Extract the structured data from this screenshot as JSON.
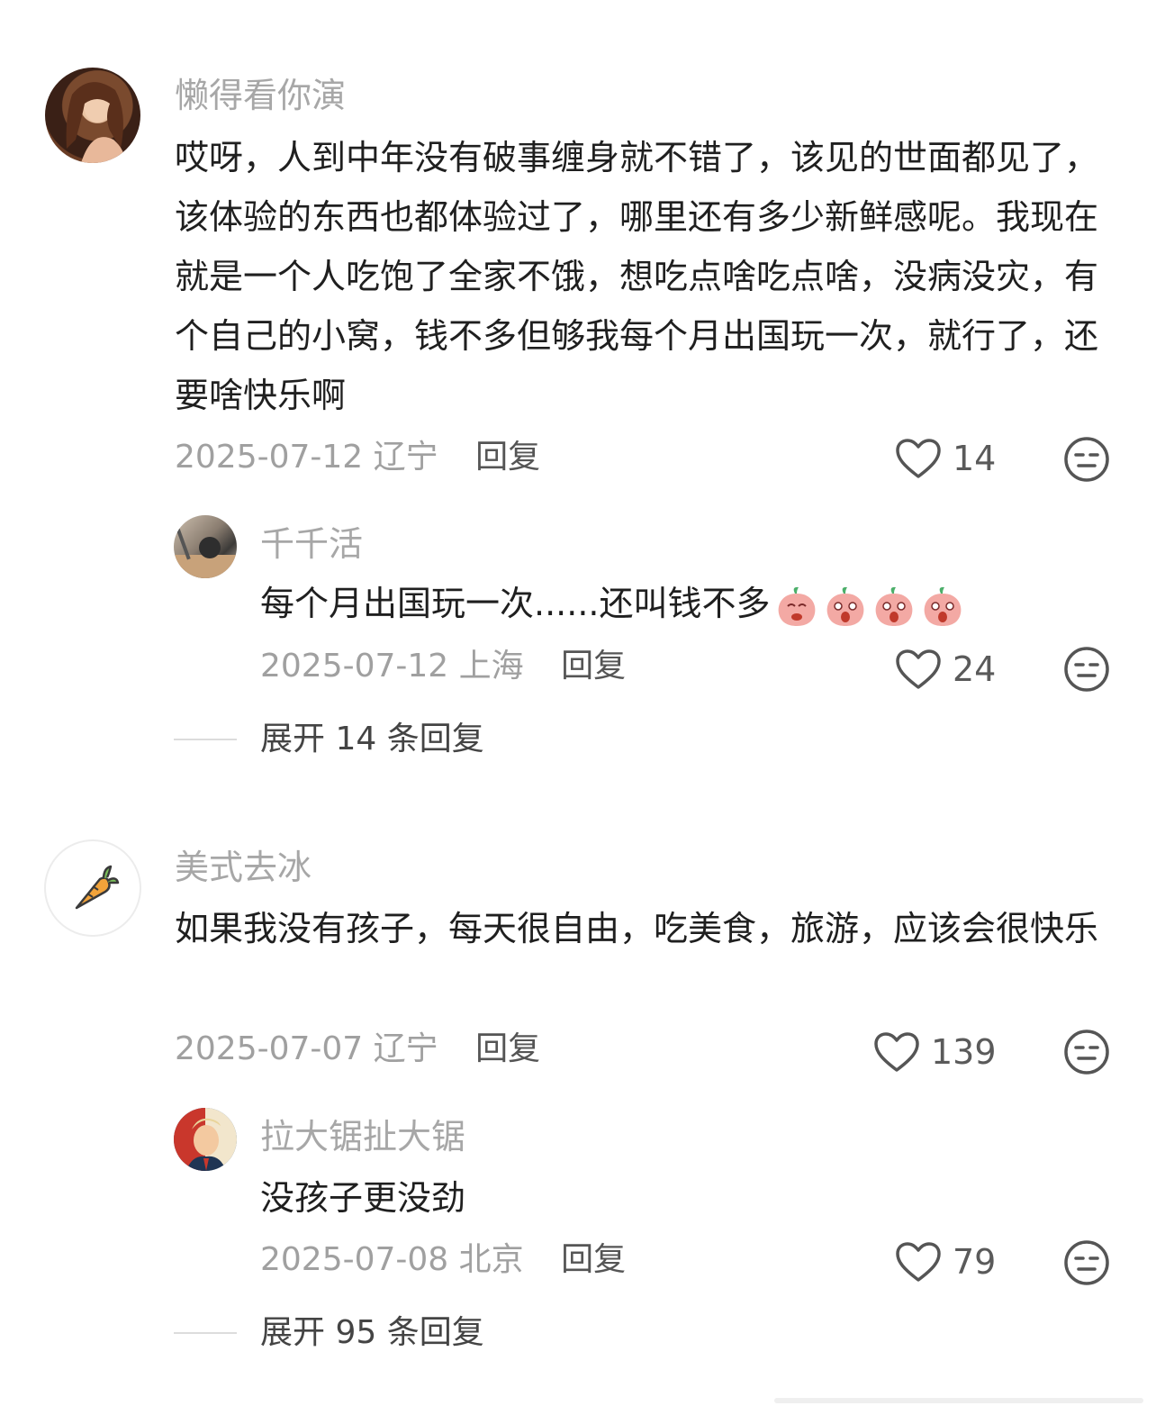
{
  "comments": [
    {
      "username": "懒得看你演",
      "text": "哎呀，人到中年没有破事缠身就不错了，该见的世面都见了，该体验的东西也都体验过了，哪里还有多少新鲜感呢。我现在就是一个人吃饱了全家不饿，想吃点啥吃点啥，没病没灾，有个自己的小窝，钱不多但够我每个月出国玩一次，就行了，还要啥快乐啊",
      "date": "2025-07-12",
      "location": "辽宁",
      "reply_label": "回复",
      "likes": "14",
      "reply": {
        "username": "千千活",
        "text": "每个月出国玩一次......还叫钱不多",
        "date": "2025-07-12",
        "location": "上海",
        "reply_label": "回复",
        "likes": "24"
      },
      "expand_label": "展开 14 条回复"
    },
    {
      "username": "美式去冰",
      "text": "如果我没有孩子，每天很自由，吃美食，旅游，应该会很快乐",
      "date": "2025-07-07",
      "location": "辽宁",
      "reply_label": "回复",
      "likes": "139",
      "reply": {
        "username": "拉大锯扯大锯",
        "text": "没孩子更没劲",
        "date": "2025-07-08",
        "location": "北京",
        "reply_label": "回复",
        "likes": "79"
      },
      "expand_label": "展开 95 条回复"
    }
  ],
  "icons": {
    "like": "heart-outline-icon",
    "dislike": "neutral-face-icon",
    "emoji": "peach-face-emoji"
  },
  "colors": {
    "username": "#a7a7a7",
    "meta": "#a0a0a0",
    "text": "#1f1f1f"
  }
}
